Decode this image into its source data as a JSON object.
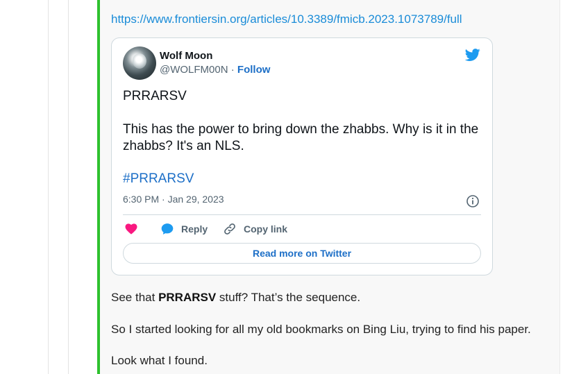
{
  "post": {
    "link_text": "https://www.frontiersin.org/articles/10.3389/fmicb.2023.1073789/full",
    "accent_color": "#2ec12e",
    "paragraphs": [
      {
        "prefix": "See that ",
        "bold": "PRRARSV",
        "suffix": " stuff? That’s the sequence."
      },
      {
        "text": "So I started looking for all my old bookmarks on Bing Liu, trying to find his paper."
      },
      {
        "text": "Look what I found."
      }
    ]
  },
  "tweet": {
    "author_name": "Wolf Moon",
    "author_handle": "@WOLFM00N",
    "separator": " · ",
    "follow_label": "Follow",
    "text_lines": [
      "PRRARSV",
      "This has the power to bring down the zhabbs.  Why is it in the zhabbs?  It's an NLS."
    ],
    "hashtag": "#PRRARSV",
    "timestamp": "6:30 PM · Jan 29, 2023",
    "reply_label": "Reply",
    "copy_link_label": "Copy link",
    "read_more_label": "Read more on Twitter",
    "colors": {
      "twitter_blue": "#1d9bf0",
      "like_pink": "#f91880",
      "link_blue": "#1d6fc7"
    },
    "icons": [
      "twitter-bird-icon",
      "info-icon",
      "heart-icon",
      "reply-bubble-icon",
      "link-icon"
    ]
  }
}
